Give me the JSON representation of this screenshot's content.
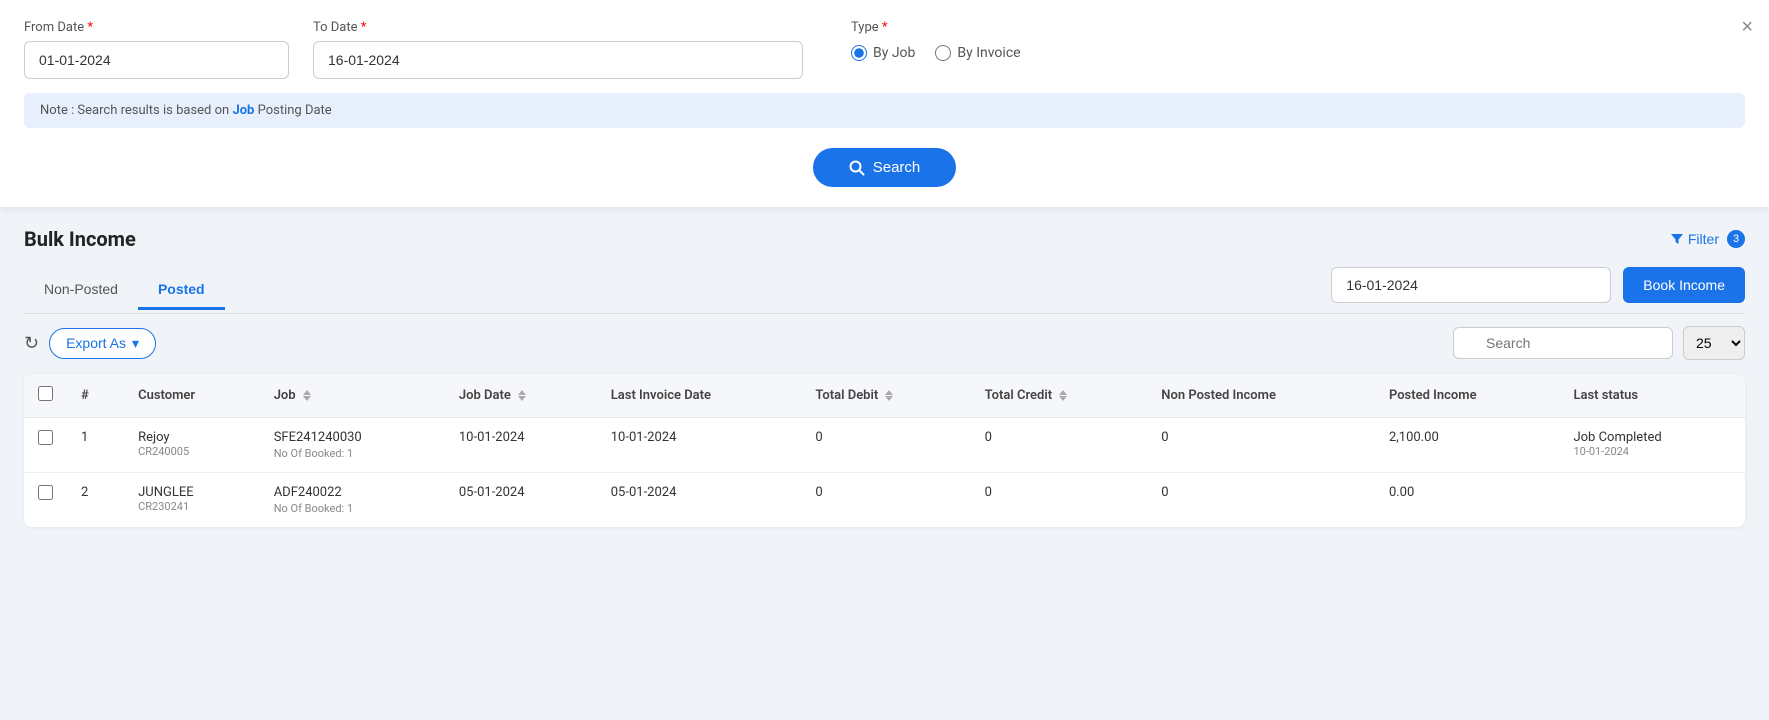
{
  "topPanel": {
    "closeLabel": "×",
    "fromDateLabel": "From Date",
    "fromDateRequired": "*",
    "fromDateValue": "01-01-2024",
    "toDateLabel": "To Date",
    "toDateRequired": "*",
    "toDateValue": "16-01-2024",
    "typeLabel": "Type",
    "typeRequired": "*",
    "byJobLabel": "By Job",
    "byInvoiceLabel": "By Invoice",
    "noteText": "Note : Search results is based on ",
    "noteKeyword": "Job",
    "noteEnd": " Posting Date",
    "searchBtnLabel": "Search"
  },
  "mainSection": {
    "title": "Bulk Income",
    "filterLabel": "Filter",
    "filterCount": "3",
    "tabs": [
      {
        "label": "Non-Posted",
        "active": false
      },
      {
        "label": "Posted",
        "active": true
      }
    ],
    "bookIncomeDateValue": "16-01-2024",
    "bookIncomeLabel": "Book Income",
    "toolbar": {
      "exportLabel": "Export As",
      "searchPlaceholder": "Search",
      "pageSizeValue": "25"
    },
    "tableHeaders": [
      {
        "label": "#",
        "sortable": false
      },
      {
        "label": "Customer",
        "sortable": false
      },
      {
        "label": "Job",
        "sortable": true
      },
      {
        "label": "Job Date",
        "sortable": true
      },
      {
        "label": "Last Invoice Date",
        "sortable": false
      },
      {
        "label": "Total Debit",
        "sortable": true
      },
      {
        "label": "Total Credit",
        "sortable": true
      },
      {
        "label": "Non Posted Income",
        "sortable": false
      },
      {
        "label": "Posted Income",
        "sortable": false
      },
      {
        "label": "Last status",
        "sortable": false
      }
    ],
    "tableRows": [
      {
        "num": "1",
        "customer": "Rejoy",
        "customerCode": "CR240005",
        "job": "SFE241240030",
        "jobBadge": "No Of Booked: 1",
        "jobDate": "10-01-2024",
        "lastInvoiceDate": "10-01-2024",
        "totalDebit": "0",
        "totalCredit": "0",
        "nonPostedIncome": "0",
        "postedIncome": "2,100.00",
        "lastStatus": "Job Completed",
        "lastStatusDate": "10-01-2024"
      },
      {
        "num": "2",
        "customer": "JUNGLEE",
        "customerCode": "CR230241",
        "job": "ADF240022",
        "jobBadge": "No Of Booked: 1",
        "jobDate": "05-01-2024",
        "lastInvoiceDate": "05-01-2024",
        "totalDebit": "0",
        "totalCredit": "0",
        "nonPostedIncome": "0",
        "postedIncome": "0.00",
        "lastStatus": "",
        "lastStatusDate": ""
      }
    ]
  }
}
